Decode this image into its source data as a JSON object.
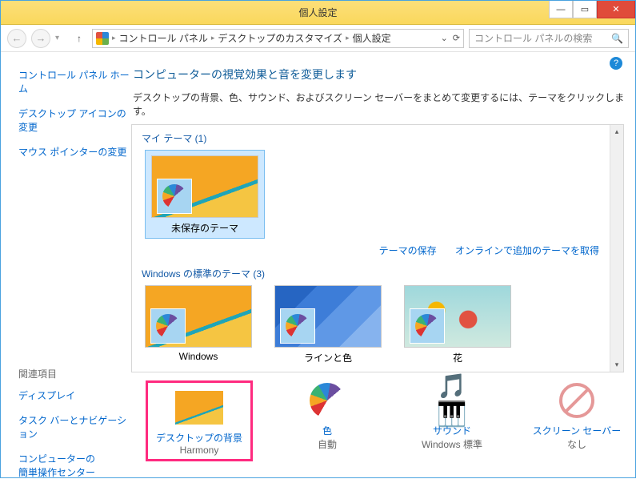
{
  "window": {
    "title": "個人設定"
  },
  "breadcrumb": {
    "root": "コントロール パネル",
    "mid": "デスクトップのカスタマイズ",
    "leaf": "個人設定"
  },
  "search": {
    "placeholder": "コントロール パネルの検索"
  },
  "sidebar": {
    "home": "コントロール パネル ホーム",
    "desktop_icons": "デスクトップ アイコンの変更",
    "mouse_pointers": "マウス ポインターの変更",
    "related_header": "関連項目",
    "display": "ディスプレイ",
    "taskbar": "タスク バーとナビゲーション",
    "ease1": "コンピューターの",
    "ease2": "簡単操作センター"
  },
  "page": {
    "title": "コンピューターの視覚効果と音を変更します",
    "desc": "デスクトップの背景、色、サウンド、およびスクリーン セーバーをまとめて変更するには、テーマをクリックします。"
  },
  "themes": {
    "my_header": "マイ テーマ (1)",
    "unsaved": "未保存のテーマ",
    "save": "テーマの保存",
    "online": "オンラインで追加のテーマを取得",
    "default_header": "Windows の標準のテーマ (3)",
    "t_windows": "Windows",
    "t_lines": "ラインと色",
    "t_flower": "花"
  },
  "settings": {
    "bg_title": "デスクトップの背景",
    "bg_sub": "Harmony",
    "color_title": "色",
    "color_sub": "自動",
    "sound_title": "サウンド",
    "sound_sub": "Windows 標準",
    "ss_title": "スクリーン セーバー",
    "ss_sub": "なし"
  }
}
